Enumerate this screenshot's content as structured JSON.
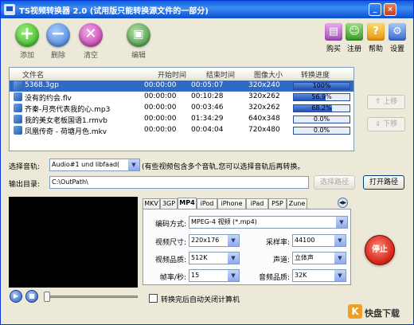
{
  "window": {
    "title": "TS视频转换器 2.0 (试用版只能转换源文件的一部分)"
  },
  "toolbar": {
    "add": "添加",
    "delete": "删除",
    "clear": "清空",
    "edit": "编辑",
    "buy": "购买",
    "register": "注册",
    "help": "帮助",
    "settings": "设置"
  },
  "filelist": {
    "columns": [
      "文件名",
      "开始时间",
      "结束时间",
      "图像大小",
      "转换进度"
    ],
    "rows": [
      {
        "name": "5368.3gp",
        "start": "00:00:00",
        "end": "00:05:07",
        "size": "320x240",
        "progress": "100%",
        "pct": 100
      },
      {
        "name": "没有的约会.flv",
        "start": "00:00:00",
        "end": "00:10:28",
        "size": "320x262",
        "progress": "56.9%",
        "pct": 56.9
      },
      {
        "name": "齐秦-月亮代表我的心.mp3",
        "start": "00:00:00",
        "end": "00:03:46",
        "size": "320x262",
        "progress": "68.2%",
        "pct": 68.2
      },
      {
        "name": "我的美女老板国语1.rmvb",
        "start": "00:00:00",
        "end": "01:34:29",
        "size": "640x348",
        "progress": "0.0%",
        "pct": 0
      },
      {
        "name": "凤凰传奇 - 荷塘月色.mkv",
        "start": "00:00:00",
        "end": "00:04:04",
        "size": "720x480",
        "progress": "0.0%",
        "pct": 0
      }
    ]
  },
  "side": {
    "up": "上移",
    "down": "下移"
  },
  "audio": {
    "label": "选择音轨:",
    "value": "Audio#1 und libfaad(",
    "hint": "(有些视频包含多个音轨,您可以选择音轨后再转换。"
  },
  "output": {
    "label": "输出目录:",
    "path": "C:\\OutPath\\",
    "choose": "选择路径",
    "open": "打开路径"
  },
  "tabs": [
    "MKV",
    "3GP",
    "MP4",
    "iPod",
    "iPhone",
    "iPad",
    "PSP",
    "Zune"
  ],
  "settings_panel": {
    "codec_label": "编码方式:",
    "codec_value": "MPEG-4 视频 (*.mp4)",
    "size_label": "视频尺寸:",
    "size_value": "220x176",
    "samplerate_label": "采样率:",
    "samplerate_value": "44100",
    "vquality_label": "视频品质:",
    "vquality_value": "512K",
    "channel_label": "声道:",
    "channel_value": "立体声",
    "fps_label": "帧率/秒:",
    "fps_value": "15",
    "aquality_label": "音频品质:",
    "aquality_value": "32K"
  },
  "stop": "停止",
  "shutdown": "转换完后自动关闭计算机",
  "logo": "快盘下载"
}
